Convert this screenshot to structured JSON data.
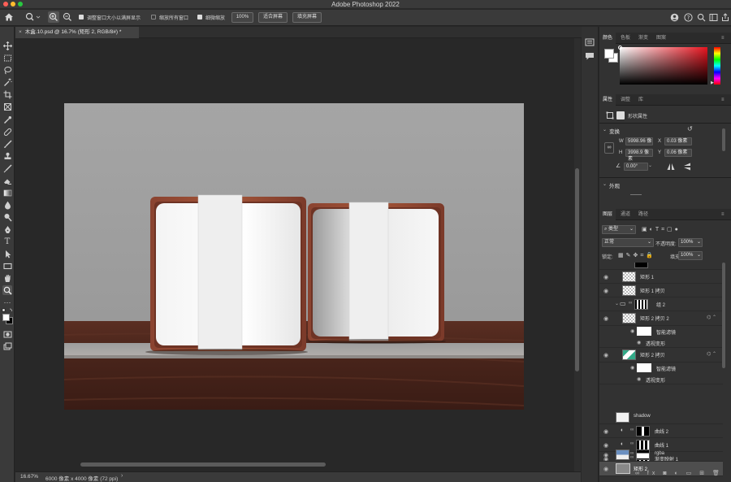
{
  "app": {
    "title": "Adobe Photoshop 2022"
  },
  "options_bar": {
    "resize_windows_label": "调整窗口大小以满屏显示",
    "resize_windows_checked": true,
    "zoom_all_label": "缩放所有窗口",
    "zoom_all_checked": false,
    "scrubby_label": "细微缩放",
    "scrubby_checked": true,
    "zoom_value": "100%",
    "fit_screen_label": "适合屏幕",
    "fill_screen_label": "填充屏幕"
  },
  "document": {
    "tab_title": "木盒.10.psd @ 16.7% (矩形 2, RGB/8#) *"
  },
  "status": {
    "zoom": "16.67%",
    "doc_info": "6000 像素 x 4000 像素 (72 ppi)"
  },
  "colors": {
    "foreground": "#ffffff",
    "background": "#000000",
    "accent": "#3a86ff"
  },
  "color_panel": {
    "tabs": [
      "颜色",
      "色板",
      "渐变",
      "图案"
    ]
  },
  "properties_panel": {
    "tabs": [
      "属性",
      "调整",
      "库"
    ],
    "kind_label": "形状属性",
    "transform_header": "变换",
    "w_label": "W",
    "w_value": "5998.96 像",
    "x_label": "X",
    "x_value": "0.03 像素",
    "h_label": "H",
    "h_value": "3998.9 像素",
    "y_label": "Y",
    "y_value": "0.06 像素",
    "angle_value": "0.00°",
    "appearance_header": "外观"
  },
  "layers_panel": {
    "tabs": [
      "图层",
      "通道",
      "路径"
    ],
    "filter_kind": "类型",
    "blend_mode": "正常",
    "opacity_label": "不透明度:",
    "opacity_value": "100%",
    "lock_label": "锁定:",
    "fill_label": "填充:",
    "fill_value": "100%",
    "layers": [
      {
        "name": "矩形 1"
      },
      {
        "name": "矩形 1 拷贝"
      },
      {
        "name": "组 2"
      },
      {
        "name": "矩形 2 拷贝 2"
      },
      {
        "name": "智能滤镜"
      },
      {
        "name": "透视变形"
      },
      {
        "name": "矩形 2 拷贝"
      },
      {
        "name": "智能滤镜"
      },
      {
        "name": "透视变形"
      },
      {
        "name": "shadow"
      },
      {
        "name": "曲线 2"
      },
      {
        "name": "曲线 1"
      },
      {
        "name": "渐变映射 1"
      },
      {
        "name": "rgba"
      },
      {
        "name": "矩形 2"
      }
    ]
  }
}
